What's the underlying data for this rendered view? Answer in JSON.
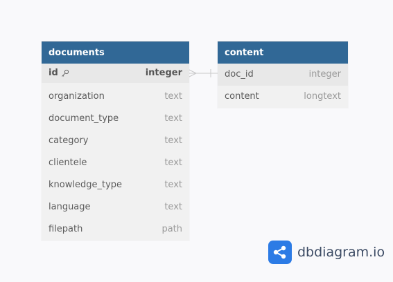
{
  "tables": {
    "documents": {
      "title": "documents",
      "columns": [
        {
          "name": "id",
          "type": "integer",
          "primary_key": true
        },
        {
          "name": "organization",
          "type": "text"
        },
        {
          "name": "document_type",
          "type": "text"
        },
        {
          "name": "category",
          "type": "text"
        },
        {
          "name": "clientele",
          "type": "text"
        },
        {
          "name": "knowledge_type",
          "type": "text"
        },
        {
          "name": "language",
          "type": "text"
        },
        {
          "name": "filepath",
          "type": "path"
        }
      ]
    },
    "content": {
      "title": "content",
      "columns": [
        {
          "name": "doc_id",
          "type": "integer"
        },
        {
          "name": "content",
          "type": "longtext"
        }
      ]
    }
  },
  "relationship": {
    "from": "documents.id",
    "to": "content.doc_id"
  },
  "brand": {
    "name": "dbdiagram",
    "suffix": ".io",
    "icon": "share-icon"
  },
  "colors": {
    "header": "#316896",
    "brand": "#2c7be5"
  }
}
